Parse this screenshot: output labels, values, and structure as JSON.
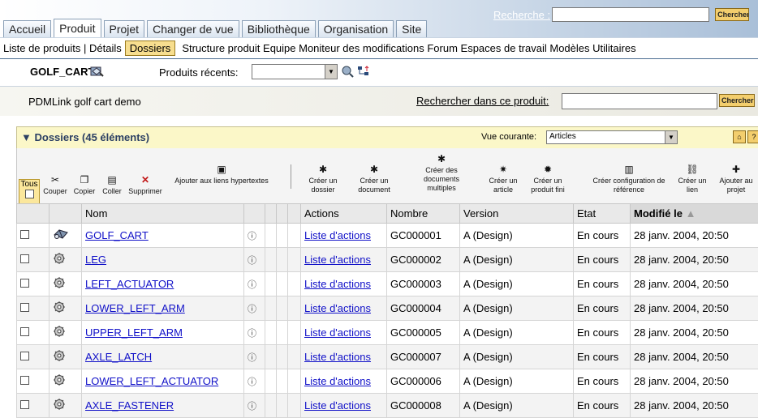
{
  "tabs": [
    "Accueil",
    "Produit",
    "Projet",
    "Changer de vue",
    "Bibliothèque",
    "Organisation",
    "Site"
  ],
  "active_tab": "Produit",
  "top_search": {
    "label": "Recherche :",
    "button": "Chercher"
  },
  "subnav": {
    "prefix": "Liste de produits | Détails",
    "selected": "Dossiers",
    "items": "Structure produit  Equipe  Moniteur des modifications  Forum  Espaces de travail  Modèles  Utilitaires"
  },
  "product": {
    "name": "GOLF_CART",
    "recent_label": "Produits récents:",
    "description": "PDMLink golf cart demo"
  },
  "product_search": {
    "label": "Rechercher dans ce produit:",
    "button": "Chercher"
  },
  "panel": {
    "title": "Dossiers (45 éléments)",
    "view_label": "Vue courante:",
    "view_value": "Articles",
    "tous_label": "Tous"
  },
  "toolbar": [
    {
      "label": "Couper",
      "icon": "scissors-icon"
    },
    {
      "label": "Copier",
      "icon": "copy-icon"
    },
    {
      "label": "Coller",
      "icon": "paste-icon"
    },
    {
      "label": "Supprimer",
      "icon": "delete-x-icon"
    },
    {
      "label": "Ajouter aux liens hypertextes",
      "icon": "add-hyperlink-icon"
    },
    {
      "label": "Créer un dossier",
      "icon": "new-folder-icon"
    },
    {
      "label": "Créer un document",
      "icon": "new-document-icon"
    },
    {
      "label": "Créer des documents multiples",
      "icon": "new-documents-icon"
    },
    {
      "label": "Créer un article",
      "icon": "new-part-icon"
    },
    {
      "label": "Créer un produit fini",
      "icon": "new-end-item-icon"
    },
    {
      "label": "Créer configuration de référence",
      "icon": "new-baseline-icon"
    },
    {
      "label": "Créer un lien",
      "icon": "new-link-icon"
    },
    {
      "label": "Ajouter au projet",
      "icon": "add-to-project-icon"
    }
  ],
  "table": {
    "headers": {
      "name": "Nom",
      "actions": "Actions",
      "number": "Nombre",
      "version": "Version",
      "state": "Etat",
      "modified": "Modifié le"
    },
    "sort_indicator": "▲",
    "rows": [
      {
        "name": "GOLF_CART",
        "actions": "Liste d'actions",
        "number": "GC000001",
        "version": "A (Design)",
        "state": "En cours",
        "modified": "28 janv. 2004, 20:50",
        "icon": "end-item-icon"
      },
      {
        "name": "LEG",
        "actions": "Liste d'actions",
        "number": "GC000002",
        "version": "A (Design)",
        "state": "En cours",
        "modified": "28 janv. 2004, 20:50",
        "icon": "part-icon"
      },
      {
        "name": "LEFT_ACTUATOR",
        "actions": "Liste d'actions",
        "number": "GC000003",
        "version": "A (Design)",
        "state": "En cours",
        "modified": "28 janv. 2004, 20:50",
        "icon": "part-icon"
      },
      {
        "name": "LOWER_LEFT_ARM",
        "actions": "Liste d'actions",
        "number": "GC000004",
        "version": "A (Design)",
        "state": "En cours",
        "modified": "28 janv. 2004, 20:50",
        "icon": "part-icon"
      },
      {
        "name": "UPPER_LEFT_ARM",
        "actions": "Liste d'actions",
        "number": "GC000005",
        "version": "A (Design)",
        "state": "En cours",
        "modified": "28 janv. 2004, 20:50",
        "icon": "part-icon"
      },
      {
        "name": "AXLE_LATCH",
        "actions": "Liste d'actions",
        "number": "GC000007",
        "version": "A (Design)",
        "state": "En cours",
        "modified": "28 janv. 2004, 20:50",
        "icon": "part-icon"
      },
      {
        "name": "LOWER_LEFT_ACTUATOR",
        "actions": "Liste d'actions",
        "number": "GC000006",
        "version": "A (Design)",
        "state": "En cours",
        "modified": "28 janv. 2004, 20:50",
        "icon": "part-icon"
      },
      {
        "name": "AXLE_FASTENER",
        "actions": "Liste d'actions",
        "number": "GC000008",
        "version": "A (Design)",
        "state": "En cours",
        "modified": "28 janv. 2004, 20:50",
        "icon": "part-icon"
      }
    ]
  },
  "colors": {
    "link": "#1010c8",
    "panel_header": "#fbf7c8",
    "selected_subnav": "#f7de8f",
    "nav_gradient_end": "#a9bfd8"
  }
}
